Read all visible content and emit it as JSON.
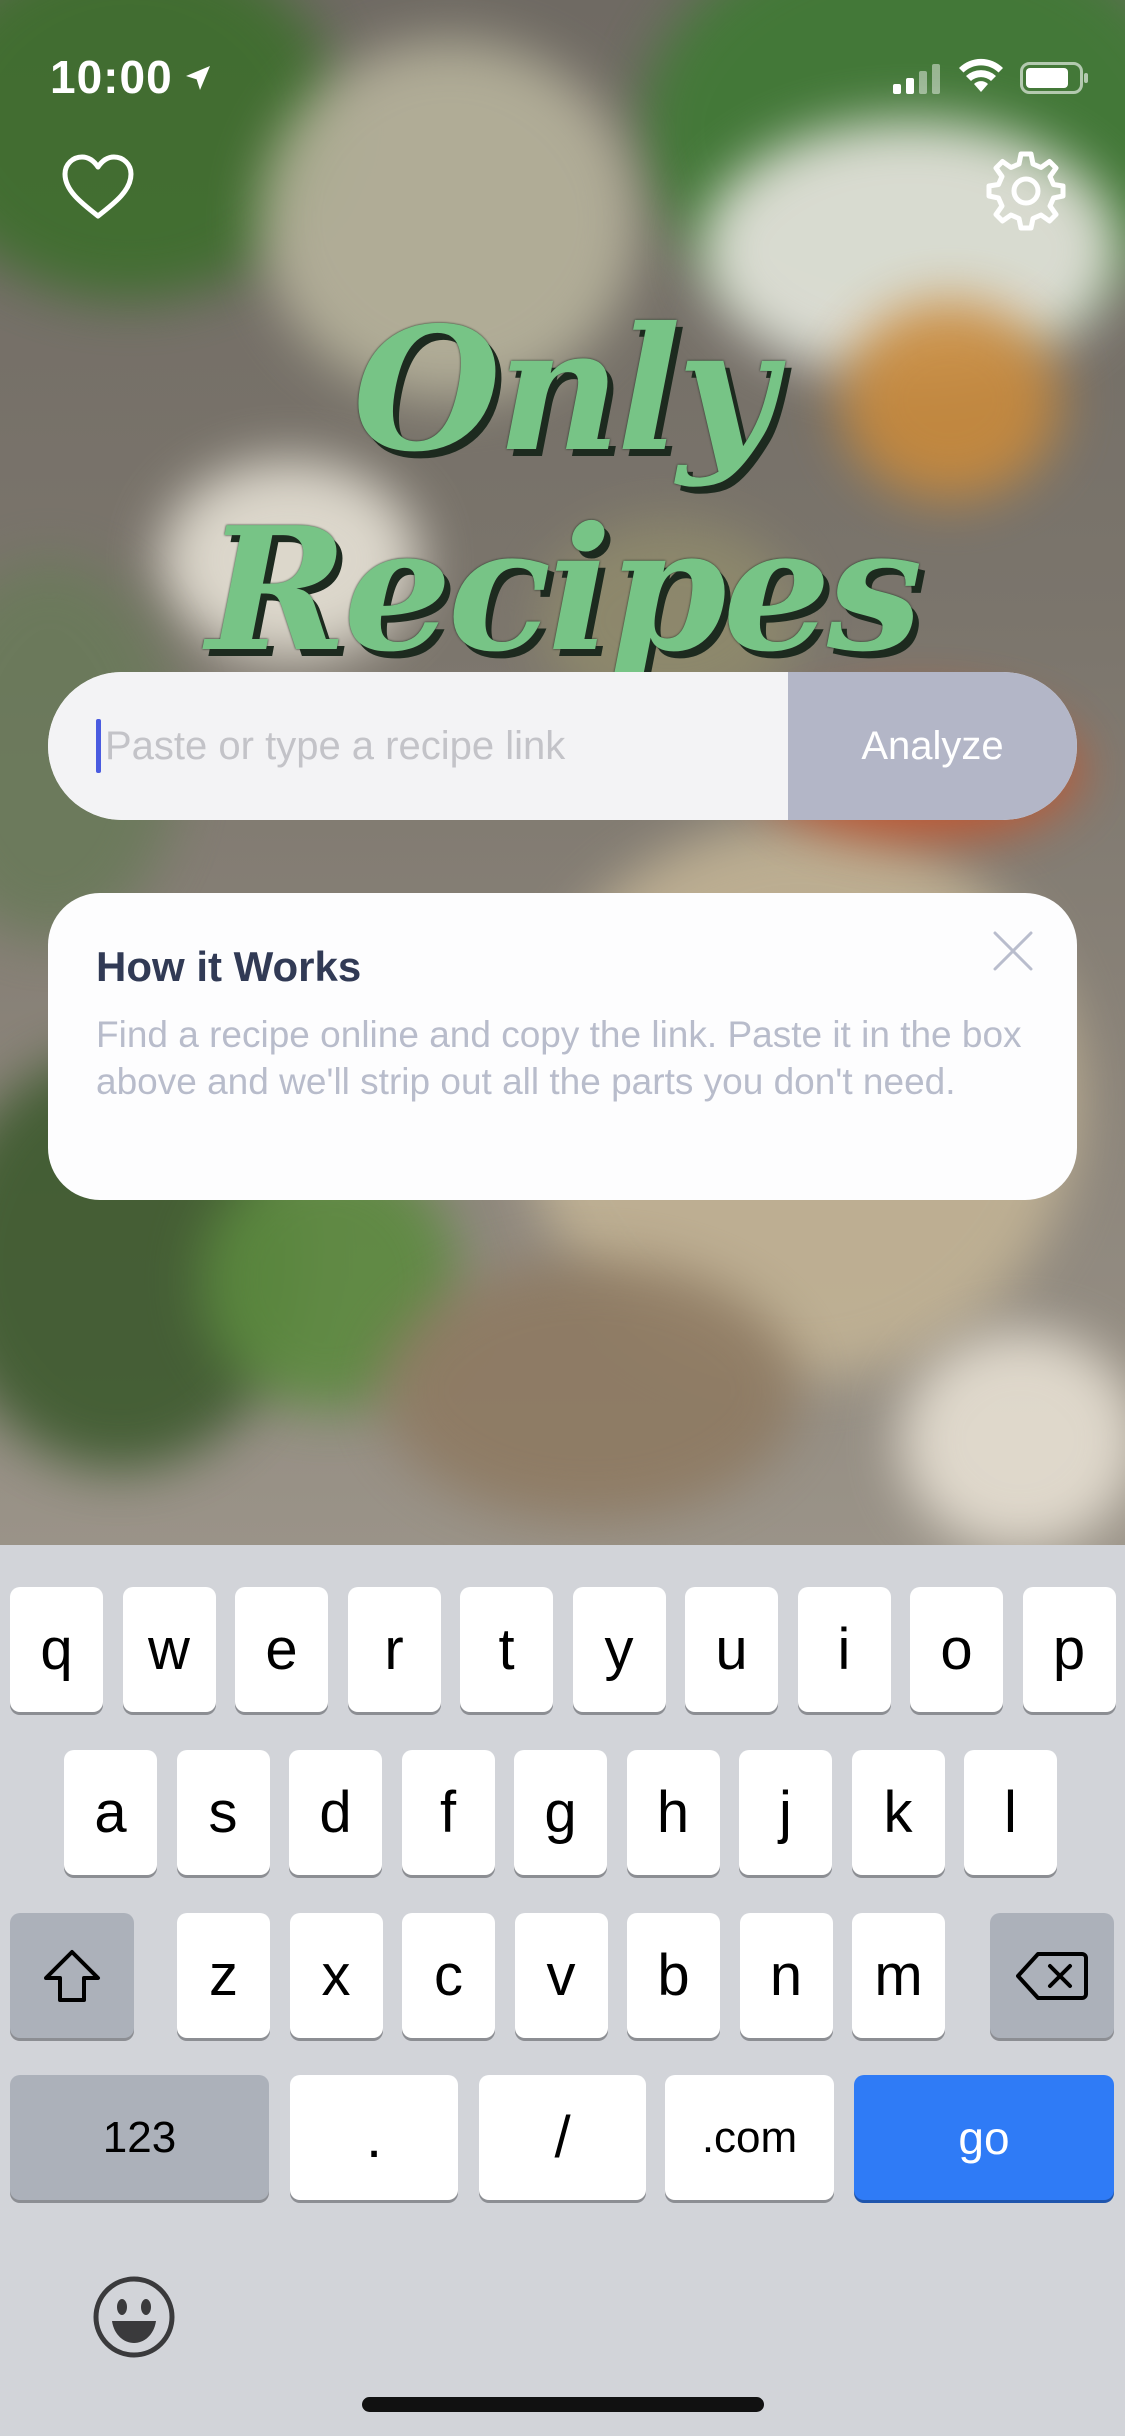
{
  "status_bar": {
    "time": "10:00"
  },
  "app": {
    "logo_text": "Only Recipes"
  },
  "search": {
    "placeholder": "Paste or type a recipe link",
    "analyze_label": "Analyze"
  },
  "how_it_works": {
    "title": "How it Works",
    "body": "Find a recipe online and copy the link. Paste it in the box above and we'll strip out all the parts you don't need."
  },
  "keyboard": {
    "row1": [
      "q",
      "w",
      "e",
      "r",
      "t",
      "y",
      "u",
      "i",
      "o",
      "p"
    ],
    "row2": [
      "a",
      "s",
      "d",
      "f",
      "g",
      "h",
      "j",
      "k",
      "l"
    ],
    "row3": [
      "z",
      "x",
      "c",
      "v",
      "b",
      "n",
      "m"
    ],
    "row4": {
      "numbers": "123",
      "dot": ".",
      "slash": "/",
      "dotcom": ".com",
      "go": "go"
    }
  },
  "colors": {
    "logo_green": "#77c486",
    "go_blue": "#2f7bf6",
    "analyze_bg": "#b3b6c7"
  }
}
